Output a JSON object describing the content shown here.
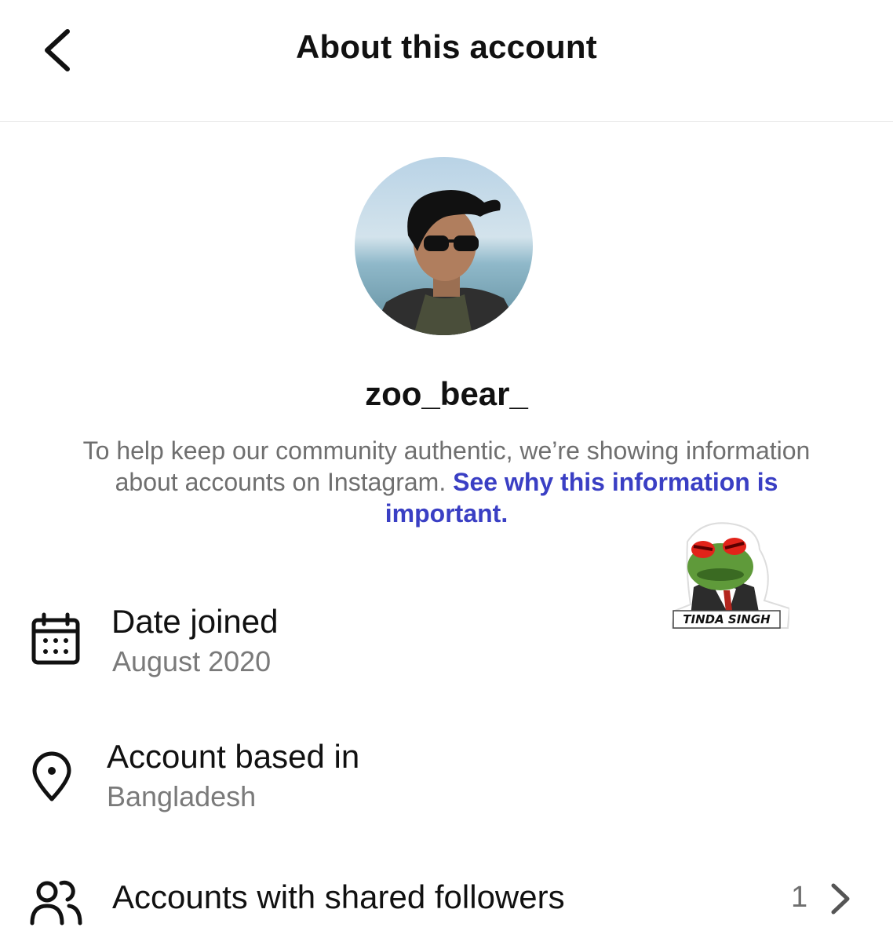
{
  "header": {
    "title": "About this account",
    "back_icon": "chevron-left-icon"
  },
  "profile": {
    "username": "zoo_bear_",
    "avatar": "profile-photo"
  },
  "info": {
    "text": "To help keep our community authentic, we’re showing information about accounts on Instagram.",
    "link": "See why this information is important."
  },
  "sticker": {
    "label": "TINDA SINGH"
  },
  "rows": {
    "date_joined": {
      "icon": "calendar-icon",
      "label": "Date joined",
      "value": "August 2020"
    },
    "based_in": {
      "icon": "location-pin-icon",
      "label": "Account based in",
      "value": "Bangladesh"
    },
    "shared_followers": {
      "icon": "people-icon",
      "label": "Accounts with shared followers",
      "count": "1",
      "chevron_icon": "chevron-right-icon"
    }
  },
  "colors": {
    "link": "#3a3fc4",
    "secondary_text": "#6f6f6f",
    "divider": "#e6e6e6"
  }
}
